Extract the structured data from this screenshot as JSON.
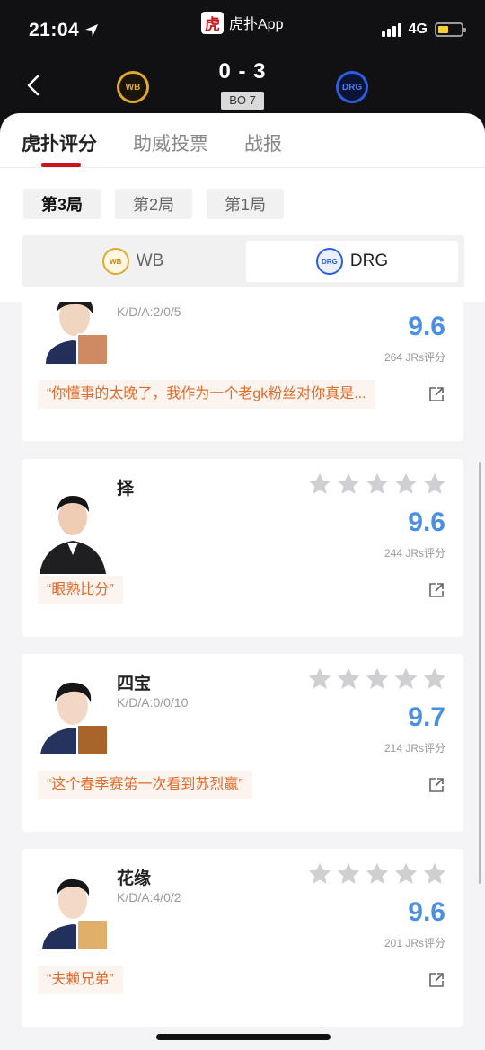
{
  "status": {
    "time": "21:04",
    "network": "4G",
    "app_name": "虎扑App",
    "app_logo_char": "虎"
  },
  "match": {
    "score": "0 - 3",
    "format": "BO 7",
    "team_left": {
      "name": "WB",
      "color": "#e0a82e"
    },
    "team_right": {
      "name": "DRG",
      "color": "#2d5de0"
    }
  },
  "tabs": [
    "虎扑评分",
    "助威投票",
    "战报"
  ],
  "games": [
    "第3局",
    "第2局",
    "第1局"
  ],
  "team_toggle": {
    "left": "WB",
    "right": "DRG",
    "selected": "DRG"
  },
  "players": [
    {
      "name": "",
      "kda": "K/D/A:2/0/5",
      "score": "9.6",
      "votes": "264 JRs评分",
      "comment": "“你懂事的太晚了，我作为一个老gk粉丝对你真是...",
      "has_hero": true,
      "hero_color": "#d08a62"
    },
    {
      "name": "择",
      "kda": "",
      "score": "9.6",
      "votes": "244 JRs评分",
      "comment": "“眼熟比分”",
      "has_hero": false,
      "hero_color": ""
    },
    {
      "name": "四宝",
      "kda": "K/D/A:0/0/10",
      "score": "9.7",
      "votes": "214 JRs评分",
      "comment": "“这个春季赛第一次看到苏烈赢”",
      "has_hero": true,
      "hero_color": "#a8642a"
    },
    {
      "name": "花缘",
      "kda": "K/D/A:4/0/2",
      "score": "9.6",
      "votes": "201 JRs评分",
      "comment": "“夫赖兄弟”",
      "has_hero": true,
      "hero_color": "#e0b06a"
    }
  ],
  "colors": {
    "accent": "#c8161d",
    "score_blue": "#4a90e2",
    "comment_orange": "#e06b2c"
  }
}
